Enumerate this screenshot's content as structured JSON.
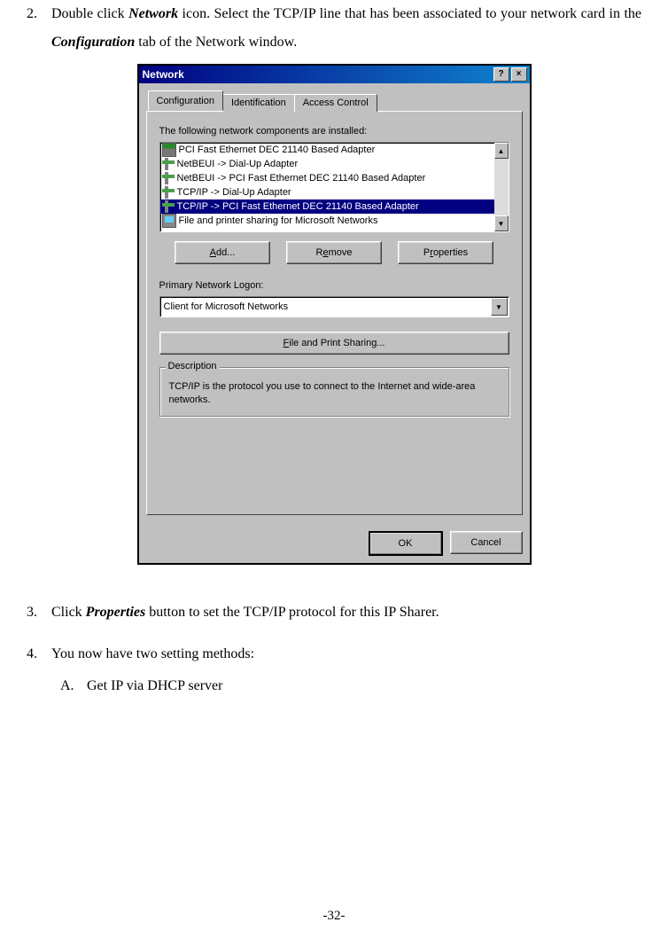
{
  "instructions": {
    "step2": {
      "num": "2.",
      "text_pre": "Double click ",
      "kw1": "Network",
      "text_mid": " icon. Select the TCP/IP line that has been associated to your network card in the ",
      "kw2": "Configuration",
      "text_post": " tab of the Network window."
    },
    "step3": {
      "num": "3.",
      "text_pre": "Click ",
      "kw1": "Properties",
      "text_post": " button to set the TCP/IP protocol for this IP Sharer."
    },
    "step4": {
      "num": "4.",
      "text": "You now have two setting methods:"
    },
    "step4a": {
      "letter": "A.",
      "text": "Get IP via DHCP server"
    }
  },
  "dialog": {
    "title": "Network",
    "help": "?",
    "close": "×",
    "tabs": {
      "t1": "Configuration",
      "t2": "Identification",
      "t3": "Access Control"
    },
    "components_label": "The following network components are installed:",
    "components": {
      "c0": "PCI Fast Ethernet DEC 21140 Based Adapter",
      "c1": "NetBEUI -> Dial-Up Adapter",
      "c2": "NetBEUI -> PCI Fast Ethernet DEC 21140 Based Adapter",
      "c3": "TCP/IP -> Dial-Up Adapter",
      "c4": "TCP/IP -> PCI Fast Ethernet DEC 21140 Based Adapter",
      "c5": "File and printer sharing for Microsoft Networks"
    },
    "buttons": {
      "add": "Add...",
      "remove": "Remove",
      "properties": "Properties",
      "add_u": "A",
      "remove_u": "R",
      "properties_u": "P",
      "fps": "File and Print Sharing...",
      "fps_u": "F",
      "ok": "OK",
      "cancel": "Cancel"
    },
    "logon_label": "Primary Network Logon:",
    "logon_value": "Client for Microsoft Networks",
    "desc_title": "Description",
    "desc_text": "TCP/IP is the protocol you use to connect to the Internet and wide-area networks."
  },
  "page_number": "-32-"
}
